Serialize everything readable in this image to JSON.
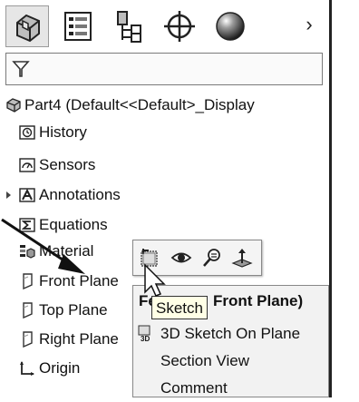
{
  "toolbar": {
    "buttons": [
      {
        "icon": "feature-manager-icon"
      },
      {
        "icon": "property-manager-icon"
      },
      {
        "icon": "configuration-manager-icon"
      },
      {
        "icon": "dimxpert-icon"
      },
      {
        "icon": "display-manager-icon"
      }
    ],
    "more_label": "›"
  },
  "filter": {
    "icon": "filter-icon"
  },
  "tree": {
    "root_label": "Part4  (Default<<Default>_Display",
    "items": [
      {
        "label": "History",
        "icon": "history-icon"
      },
      {
        "label": "Sensors",
        "icon": "sensors-icon"
      },
      {
        "label": "Annotations",
        "icon": "annotations-icon"
      },
      {
        "label": "Equations",
        "icon": "equations-icon"
      },
      {
        "label": "Material",
        "icon": "material-icon"
      },
      {
        "label": "Front Plane",
        "icon": "plane-icon"
      },
      {
        "label": "Top Plane",
        "icon": "plane-icon"
      },
      {
        "label": "Right Plane",
        "icon": "plane-icon"
      },
      {
        "label": "Origin",
        "icon": "origin-icon"
      }
    ]
  },
  "context_toolbar": {
    "icons": [
      "sketch-icon",
      "show-icon",
      "zoom-to-selection-icon",
      "normal-to-icon"
    ]
  },
  "context_menu": {
    "header": "Features (Front Plane)",
    "header_visible": "Fe",
    "header_rest": "Front Plane)",
    "items": [
      {
        "label": "3D Sketch On Plane",
        "underline": "3"
      },
      {
        "label": "Section View",
        "underline": "e"
      },
      {
        "label": "Comment"
      }
    ]
  },
  "tooltip": {
    "text": "Sketch"
  }
}
